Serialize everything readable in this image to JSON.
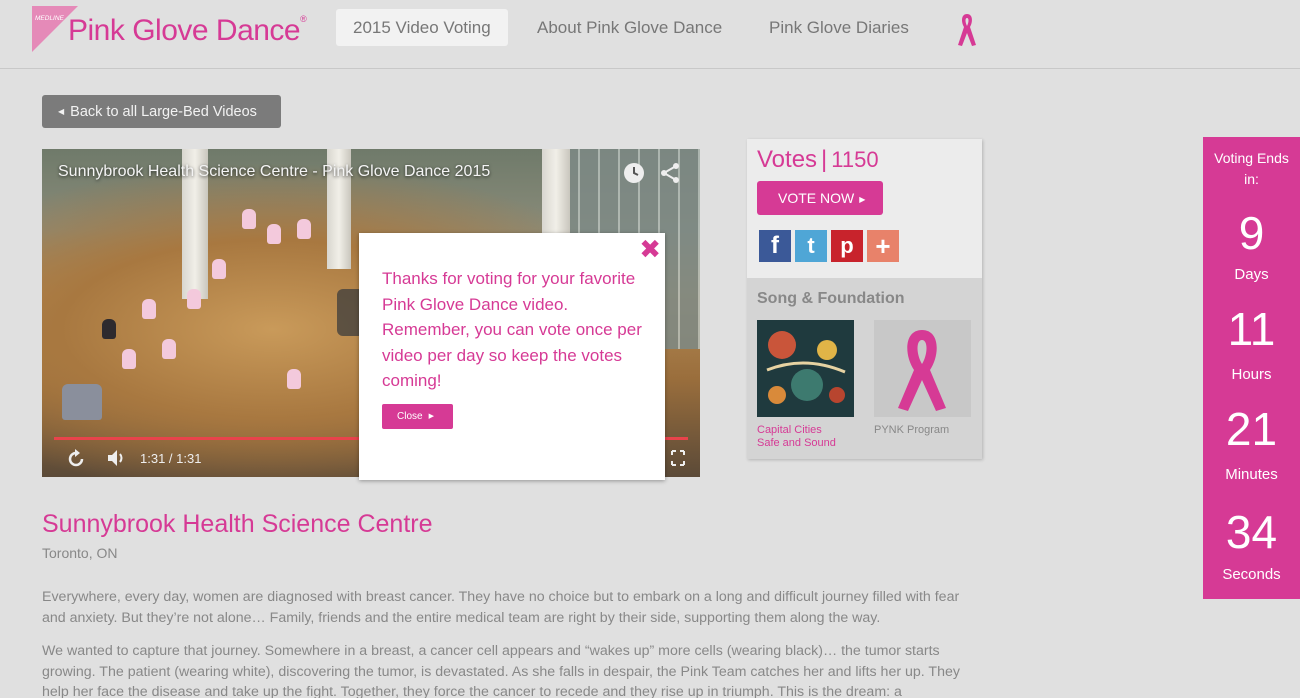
{
  "header": {
    "logo_badge": "MEDLINE",
    "logo_text": "Pink Glove Dance",
    "logo_reg": "®",
    "nav": [
      {
        "label": "2015 Video Voting",
        "active": true
      },
      {
        "label": "About Pink Glove Dance",
        "active": false
      },
      {
        "label": "Pink Glove Diaries",
        "active": false
      }
    ],
    "ribbon_icon": "pink-ribbon-icon"
  },
  "back_button": {
    "label": "Back to all Large-Bed Videos",
    "icon": "caret-left-icon"
  },
  "video": {
    "title": "Sunnybrook Health Science Centre - Pink Glove Dance 2015",
    "time": "1:31 / 1:31",
    "progress": 1.0,
    "icons": [
      "clock-icon",
      "share-icon",
      "replay-icon",
      "volume-icon",
      "fullscreen-icon"
    ]
  },
  "modal": {
    "close_glyph": "✖",
    "message": "Thanks for voting for your favorite Pink Glove Dance video. Remember, you can vote once per video per day so keep the votes coming!",
    "close_label": "Close"
  },
  "votes": {
    "label": "Votes",
    "separator": "|",
    "count": "1150",
    "vote_button": "VOTE NOW",
    "social": [
      {
        "name": "facebook",
        "glyph": "f",
        "color": "#3b5998"
      },
      {
        "name": "twitter",
        "glyph": "t",
        "color": "#4fa6d6"
      },
      {
        "name": "pinterest",
        "glyph": "p",
        "color": "#c8232c"
      },
      {
        "name": "addthis",
        "glyph": "+",
        "color": "#e8826a"
      }
    ]
  },
  "song": {
    "title": "Song & Foundation",
    "items": [
      {
        "caption_line1": "Capital Cities",
        "caption_line2": "Safe and Sound",
        "color": "#d63a95"
      },
      {
        "caption_line1": "PYNK Program",
        "caption_line2": "",
        "color": "#888888"
      }
    ]
  },
  "countdown": {
    "heading_line1": "Voting Ends",
    "heading_line2": "in:",
    "units": [
      {
        "value": "9",
        "label": "Days"
      },
      {
        "value": "11",
        "label": "Hours"
      },
      {
        "value": "21",
        "label": "Minutes"
      },
      {
        "value": "34",
        "label": "Seconds"
      }
    ]
  },
  "entry": {
    "name": "Sunnybrook Health Science Centre",
    "location": "Toronto, ON",
    "paragraphs": [
      "Everywhere, every day, women are diagnosed with breast cancer.   They have no choice but to embark on a long and difficult journey filled with fear and anxiety.  But they’re not alone… Family, friends and the entire medical team are right by their side, supporting them along the way.",
      "We wanted to capture that journey.  Somewhere in a breast, a cancer cell appears and “wakes up” more cells (wearing black)… the tumor starts growing. The patient (wearing white),  discovering the tumor,  is devastated. As she falls in despair, the Pink Team catches her and lifts her up. They help her face the disease and take up the fight.  Together, they force the cancer to recede and they rise up in triumph.  This is the dream: a"
    ]
  },
  "colors": {
    "accent": "#d63a95",
    "background": "#e0e0e0",
    "muted": "#777777"
  }
}
